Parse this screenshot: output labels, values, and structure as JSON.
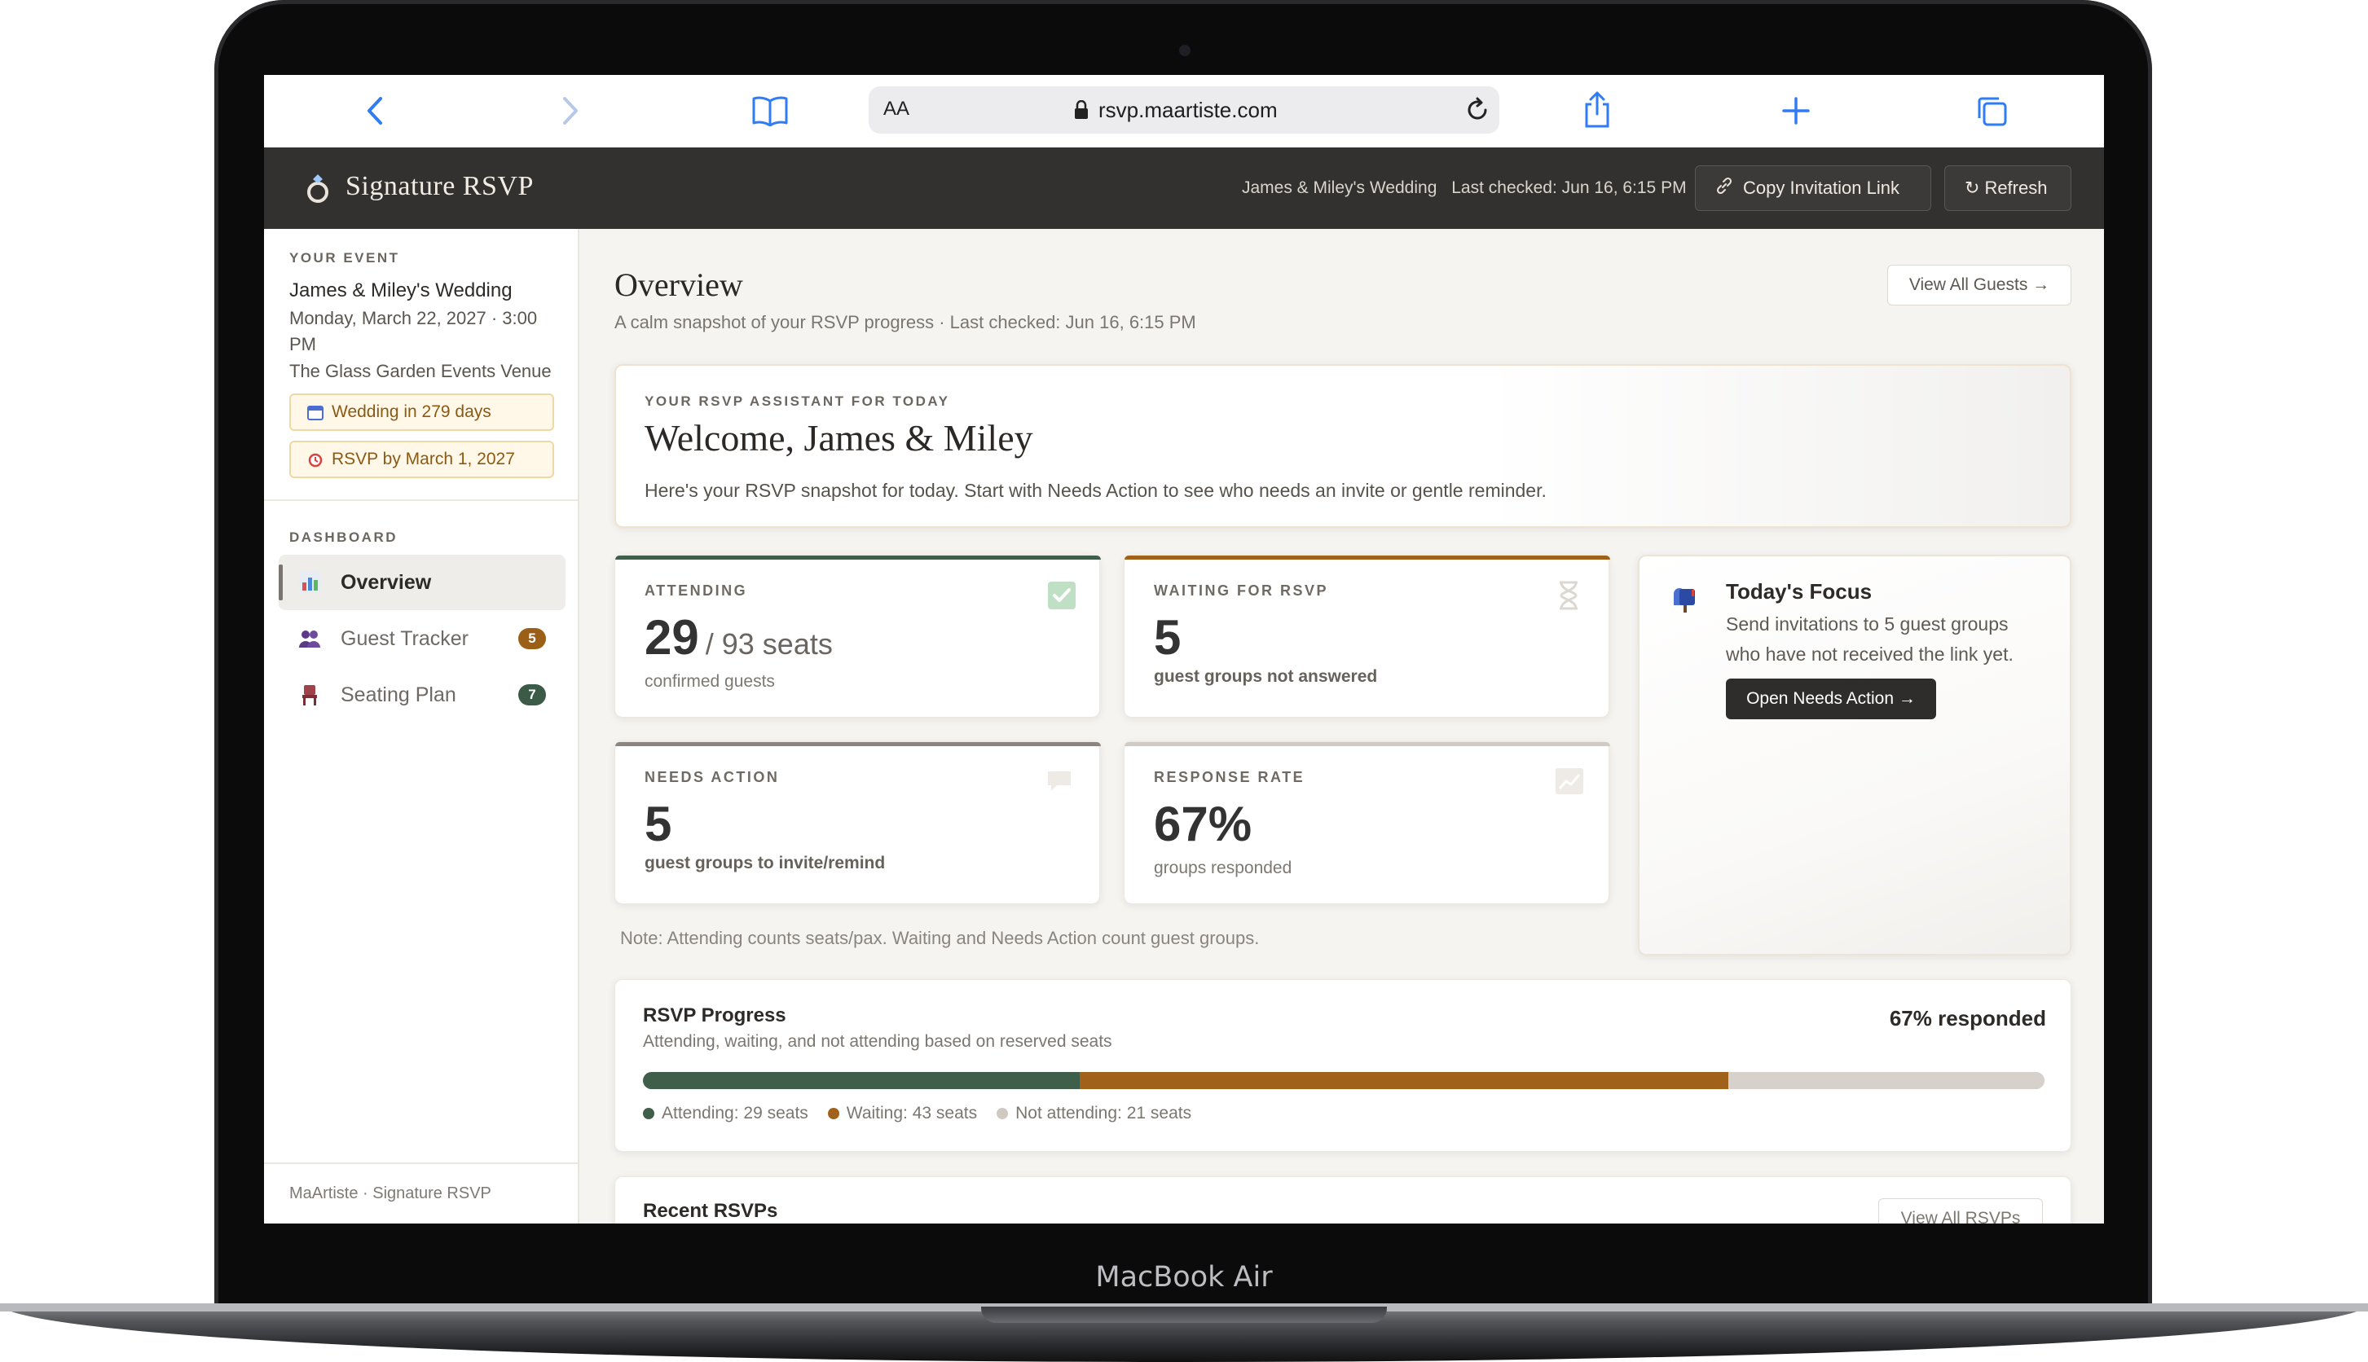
{
  "device_label": "MacBook Air",
  "browser": {
    "text_size_label": "AA",
    "url": "rsvp.maartiste.com"
  },
  "header": {
    "brand": "Signature RSVP",
    "event_name": "James & Miley's Wedding",
    "last_checked": "Last checked: Jun 16, 6:15 PM",
    "copy_link_label": "Copy Invitation Link",
    "refresh_label": "Refresh"
  },
  "sidebar": {
    "your_event_label": "YOUR EVENT",
    "event_title": "James & Miley's Wedding",
    "event_date_line1": "Monday, March 22, 2027 · 3:00",
    "event_date_line2": "PM",
    "venue": "The Glass Garden Events Venue",
    "countdown_pill": "Wedding in 279 days",
    "rsvp_deadline_pill": "RSVP by March 1, 2027",
    "dashboard_label": "DASHBOARD",
    "nav": [
      {
        "label": "Overview",
        "badge": ""
      },
      {
        "label": "Guest Tracker",
        "badge": "5"
      },
      {
        "label": "Seating Plan",
        "badge": "7"
      }
    ],
    "footer": "MaArtiste · Signature RSVP"
  },
  "main": {
    "title": "Overview",
    "subtitle": "A calm snapshot of your RSVP progress · Last checked: Jun 16, 6:15 PM",
    "view_all_guests": "View All Guests →",
    "assistant": {
      "eyebrow": "YOUR RSVP ASSISTANT FOR TODAY",
      "heading": "Welcome, James & Miley",
      "body": "Here's your RSVP snapshot for today. Start with Needs Action to see who needs an invite or gentle reminder."
    },
    "stats": {
      "attending": {
        "label": "ATTENDING",
        "value": "29",
        "of": "/ 93 seats",
        "sub": "confirmed guests"
      },
      "waiting": {
        "label": "WAITING FOR RSVP",
        "value": "5",
        "sub": "guest groups not answered"
      },
      "needs_action": {
        "label": "NEEDS ACTION",
        "value": "5",
        "sub": "guest groups to invite/remind"
      },
      "response_rate": {
        "label": "RESPONSE RATE",
        "value": "67%",
        "sub": "groups responded"
      }
    },
    "focus": {
      "title": "Today's Focus",
      "body_line1": "Send invitations to 5 guest groups",
      "body_line2": "who have not received the link yet.",
      "button": "Open Needs Action →"
    },
    "note": "Note: Attending counts seats/pax. Waiting and Needs Action count guest groups.",
    "progress": {
      "title": "RSVP Progress",
      "subtitle": "Attending, waiting, and not attending based on reserved seats",
      "summary": "67% responded",
      "attending_seats": 29,
      "waiting_seats": 43,
      "not_attending_seats": 21,
      "legend_attending": "Attending: 29 seats",
      "legend_waiting": "Waiting: 43 seats",
      "legend_not": "Not attending: 21 seats",
      "colors": {
        "attending": "#3f5f4a",
        "waiting": "#a0621a",
        "not_attending": "#d6d1ca"
      }
    },
    "recent": {
      "title": "Recent RSVPs",
      "view_all": "View All RSVPs"
    }
  }
}
